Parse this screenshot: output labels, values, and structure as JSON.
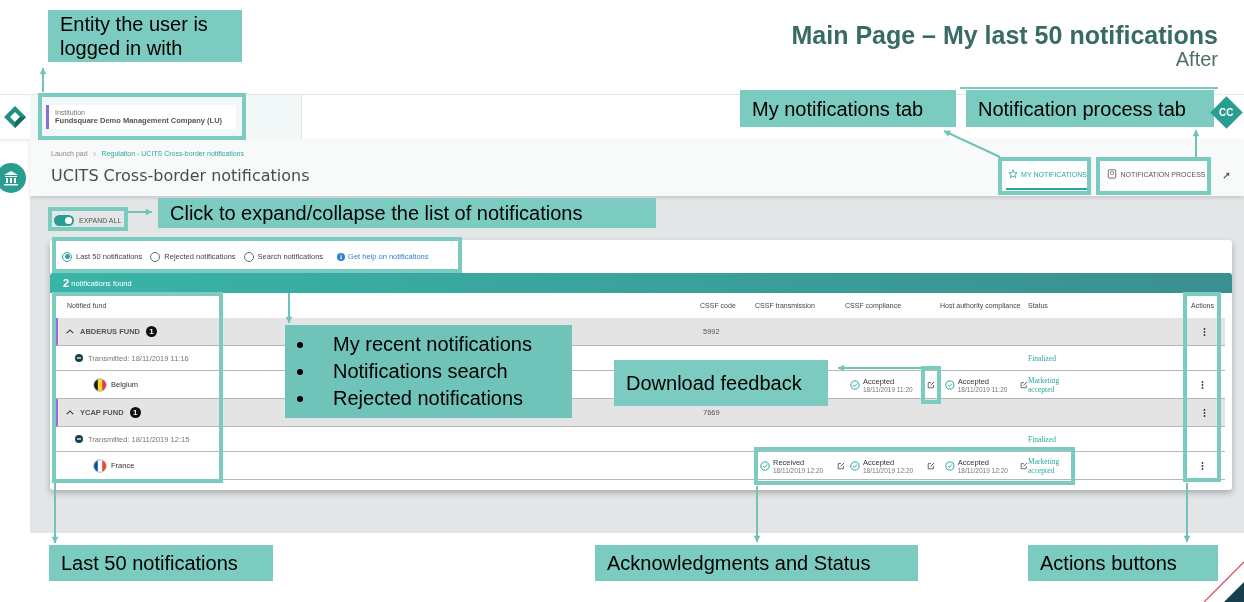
{
  "slide": {
    "title": "Main Page – My last 50 notifications",
    "subtitle": "After"
  },
  "app": {
    "institution": {
      "label": "Institution",
      "name": "Fundsquare Demo Management Company (LU)"
    },
    "avatar": "CC",
    "breadcrumb": [
      "Launch pad",
      "Regulation - UCITS Cross-border notifications"
    ],
    "page_title": "UCITS Cross-border notifications",
    "tabs": [
      {
        "label": "MY NOTIFICATIONS",
        "kind": "star",
        "selected": true
      },
      {
        "label": "NOTIFICATION PROCESS",
        "kind": "book",
        "selected": false
      }
    ],
    "expand_all": {
      "label": "EXPAND ALL",
      "on": true
    },
    "filters": [
      {
        "label": "Last 50 notifications",
        "selected": true
      },
      {
        "label": "Rejected notifications",
        "selected": false
      },
      {
        "label": "Search notifications",
        "selected": false
      }
    ],
    "help_link": "Get help on notifications",
    "results": {
      "count": "2",
      "text": "notifications found"
    },
    "columns": [
      "Notified fund",
      "CSSF code",
      "CSSF transmission",
      "CSSF compliance",
      "Host authority compliance",
      "Status",
      "Actions"
    ],
    "funds": [
      {
        "name": "ABDERUS FUND",
        "count": "1",
        "code": "5992",
        "expanded": true,
        "transmissions": [
          {
            "label": "Transmitted: 18/11/2019 11:16",
            "status": "Finalized",
            "expanded": true,
            "countries": [
              {
                "name": "Belgium",
                "kind": "be",
                "compliance": {
                  "state": "Accepted",
                  "date": "18/11/2019 11:20"
                },
                "host": {
                  "state": "Accepted",
                  "date": "18/11/2019 11:20"
                },
                "status": "Marketing accepted"
              }
            ]
          }
        ]
      },
      {
        "name": "YCAP FUND",
        "count": "1",
        "code": "7669",
        "expanded": true,
        "transmissions": [
          {
            "label": "Transmitted: 18/11/2019 12:15",
            "status": "Finalized",
            "expanded": true,
            "countries": [
              {
                "name": "France",
                "kind": "fr",
                "transmission": {
                  "state": "Received",
                  "date": "18/11/2019 12:20"
                },
                "compliance": {
                  "state": "Accepted",
                  "date": "18/11/2019 12:20"
                },
                "host": {
                  "state": "Accepted",
                  "date": "18/11/2019 12:20"
                },
                "status": "Marketing accepted"
              }
            ]
          }
        ]
      }
    ]
  },
  "callouts": [
    {
      "kind": "text",
      "text": "Entity the user is logged in with"
    },
    {
      "kind": "text",
      "text": "My notifications tab"
    },
    {
      "kind": "text",
      "text": "Notification process tab"
    },
    {
      "kind": "text",
      "text": "Click to expand/collapse the list of notifications"
    },
    {
      "kind": "bullets",
      "items": [
        "My recent notifications",
        "Notifications search",
        "Rejected notifications"
      ]
    },
    {
      "kind": "text",
      "text": "Download feedback"
    },
    {
      "kind": "text",
      "text": "Last 50 notifications"
    },
    {
      "kind": "text",
      "text": "Acknowledgments and Status"
    },
    {
      "kind": "text",
      "text": "Actions buttons"
    }
  ]
}
